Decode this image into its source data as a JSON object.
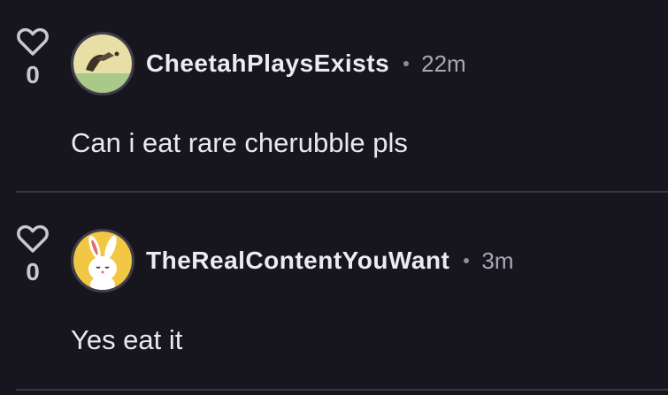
{
  "comments": [
    {
      "likes": "0",
      "username": "CheetahPlaysExists",
      "time": "22m",
      "text": "Can i eat rare cherubble pls",
      "avatar_icon": "cheetah-avatar-icon"
    },
    {
      "likes": "0",
      "username": "TheRealContentYouWant",
      "time": "3m",
      "text": "Yes eat it",
      "avatar_icon": "bunny-avatar-icon"
    }
  ],
  "colors": {
    "background": "#17161f",
    "text": "#e9e8ee",
    "muted": "#a9a8b4",
    "divider": "#3a3944"
  }
}
